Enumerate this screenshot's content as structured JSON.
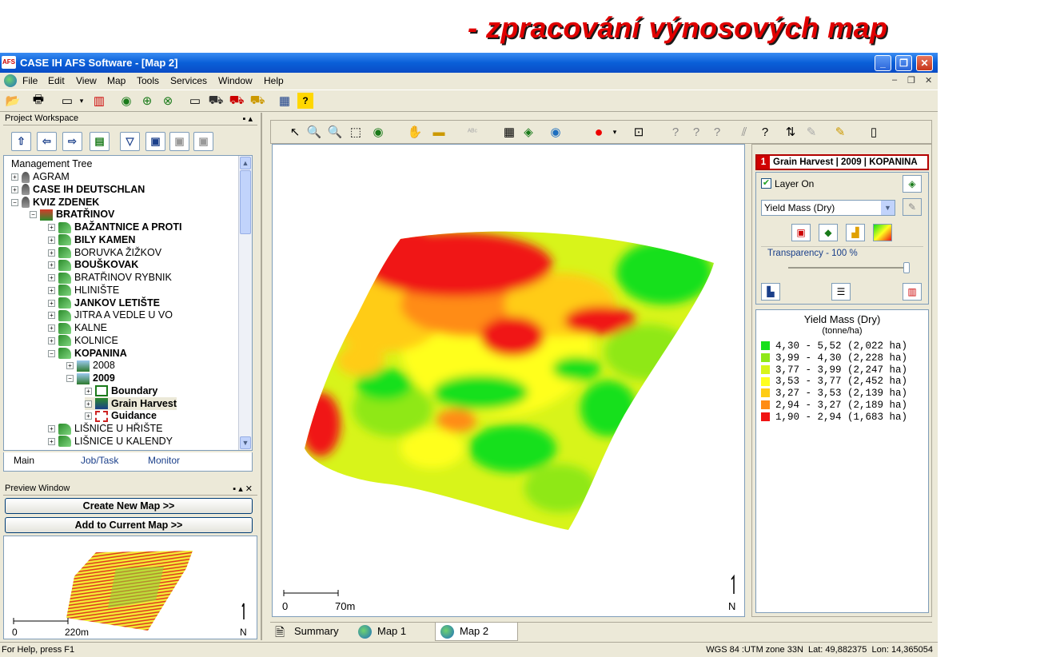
{
  "slide_title": "- zpracování výnosových map",
  "window": {
    "title": "CASE IH AFS Software - [Map 2]",
    "logo": "AFS",
    "controls": [
      "_",
      "❐",
      "✕"
    ]
  },
  "menubar": {
    "items": [
      "File",
      "Edit",
      "View",
      "Map",
      "Tools",
      "Services",
      "Window",
      "Help"
    ],
    "mdi_controls": [
      "–",
      "❐",
      "✕"
    ]
  },
  "workspace": {
    "header": "Project Workspace",
    "header_controls": "▪ ▴",
    "tree_label": "Management Tree",
    "tree": [
      {
        "label": "AGRAM",
        "bold": false,
        "depth": 0,
        "expander": "+",
        "icon": "person"
      },
      {
        "label": "CASE IH DEUTSCHLAN",
        "bold": true,
        "depth": 0,
        "expander": "+",
        "icon": "person"
      },
      {
        "label": "KVIZ ZDENEK",
        "bold": true,
        "depth": 0,
        "expander": "−",
        "icon": "person"
      },
      {
        "label": "BRATŘINOV",
        "bold": true,
        "depth": 1,
        "expander": "−",
        "icon": "farm"
      },
      {
        "label": "BAŽANTNICE A PROTI",
        "bold": true,
        "depth": 2,
        "expander": "+",
        "icon": "field"
      },
      {
        "label": "BILY KAMEN",
        "bold": true,
        "depth": 2,
        "expander": "+",
        "icon": "field"
      },
      {
        "label": "BORUVKA ŽIŽKOV",
        "bold": false,
        "depth": 2,
        "expander": "+",
        "icon": "field"
      },
      {
        "label": "BOUŠKOVAK",
        "bold": true,
        "depth": 2,
        "expander": "+",
        "icon": "field"
      },
      {
        "label": "BRATŘINOV RYBNIK",
        "bold": false,
        "depth": 2,
        "expander": "+",
        "icon": "field"
      },
      {
        "label": "HLINIŠTE",
        "bold": false,
        "depth": 2,
        "expander": "+",
        "icon": "field"
      },
      {
        "label": "JANKOV LETIŠTE",
        "bold": true,
        "depth": 2,
        "expander": "+",
        "icon": "field"
      },
      {
        "label": "JITRA A VEDLE U VO",
        "bold": false,
        "depth": 2,
        "expander": "+",
        "icon": "field"
      },
      {
        "label": "KALNE",
        "bold": false,
        "depth": 2,
        "expander": "+",
        "icon": "field"
      },
      {
        "label": "KOLNICE",
        "bold": false,
        "depth": 2,
        "expander": "+",
        "icon": "field"
      },
      {
        "label": "KOPANINA",
        "bold": true,
        "depth": 2,
        "expander": "−",
        "icon": "field"
      },
      {
        "label": "2008",
        "bold": false,
        "depth": 3,
        "expander": "+",
        "icon": "year"
      },
      {
        "label": "2009",
        "bold": true,
        "depth": 3,
        "expander": "−",
        "icon": "year"
      },
      {
        "label": "Boundary",
        "bold": true,
        "depth": 4,
        "expander": "+",
        "icon": "bound"
      },
      {
        "label": "Grain Harvest",
        "bold": true,
        "depth": 4,
        "expander": "+",
        "icon": "harv"
      },
      {
        "label": "Guidance",
        "bold": true,
        "depth": 4,
        "expander": "+",
        "icon": "guid"
      },
      {
        "label": "LIŠNICE U HŘIŠTE",
        "bold": false,
        "depth": 2,
        "expander": "+",
        "icon": "field"
      },
      {
        "label": "LIŠNICE U KALENDY",
        "bold": false,
        "depth": 2,
        "expander": "+",
        "icon": "field"
      }
    ],
    "tabs": [
      "Main",
      "Job/Task",
      "Monitor"
    ]
  },
  "preview": {
    "header": "Preview Window",
    "header_controls": "▪ ▴ ✕",
    "create_button": "Create New Map  >>",
    "add_button": "Add to Current Map  >>",
    "scale_zero": "0",
    "scale_label": "220m",
    "north": "N"
  },
  "map": {
    "scale_zero": "0",
    "scale_label": "70m",
    "north": "N"
  },
  "layer": {
    "index": "1",
    "title": "Grain Harvest | 2009 | KOPANINA",
    "layer_on_label": "Layer On",
    "layer_on_checked": true,
    "attribute": "Yield Mass (Dry)",
    "transparency_label": "Transparency - 100 %",
    "transparency_value": 100,
    "legend_title": "Yield Mass (Dry)",
    "legend_unit": "(tonne/ha)",
    "legend": [
      {
        "range": "4,30 - 5,52 (2,022 ha)",
        "color": "#17e01a"
      },
      {
        "range": "3,99 - 4,30 (2,228 ha)",
        "color": "#8fe818"
      },
      {
        "range": "3,77 - 3,99 (2,247 ha)",
        "color": "#d8f41a"
      },
      {
        "range": "3,53 - 3,77 (2,452 ha)",
        "color": "#ffff1e"
      },
      {
        "range": "3,27 - 3,53 (2,139 ha)",
        "color": "#ffcc14"
      },
      {
        "range": "2,94 - 3,27 (2,189 ha)",
        "color": "#ff8c14"
      },
      {
        "range": "1,90 - 2,94 (1,683 ha)",
        "color": "#f01414"
      }
    ]
  },
  "bottom_tabs": [
    "Summary",
    "Map 1",
    "Map 2"
  ],
  "status": {
    "help": "For Help, press F1",
    "coords": "WGS 84 :UTM zone 33N  Lat: 49,882375  Lon: 14,365054"
  }
}
